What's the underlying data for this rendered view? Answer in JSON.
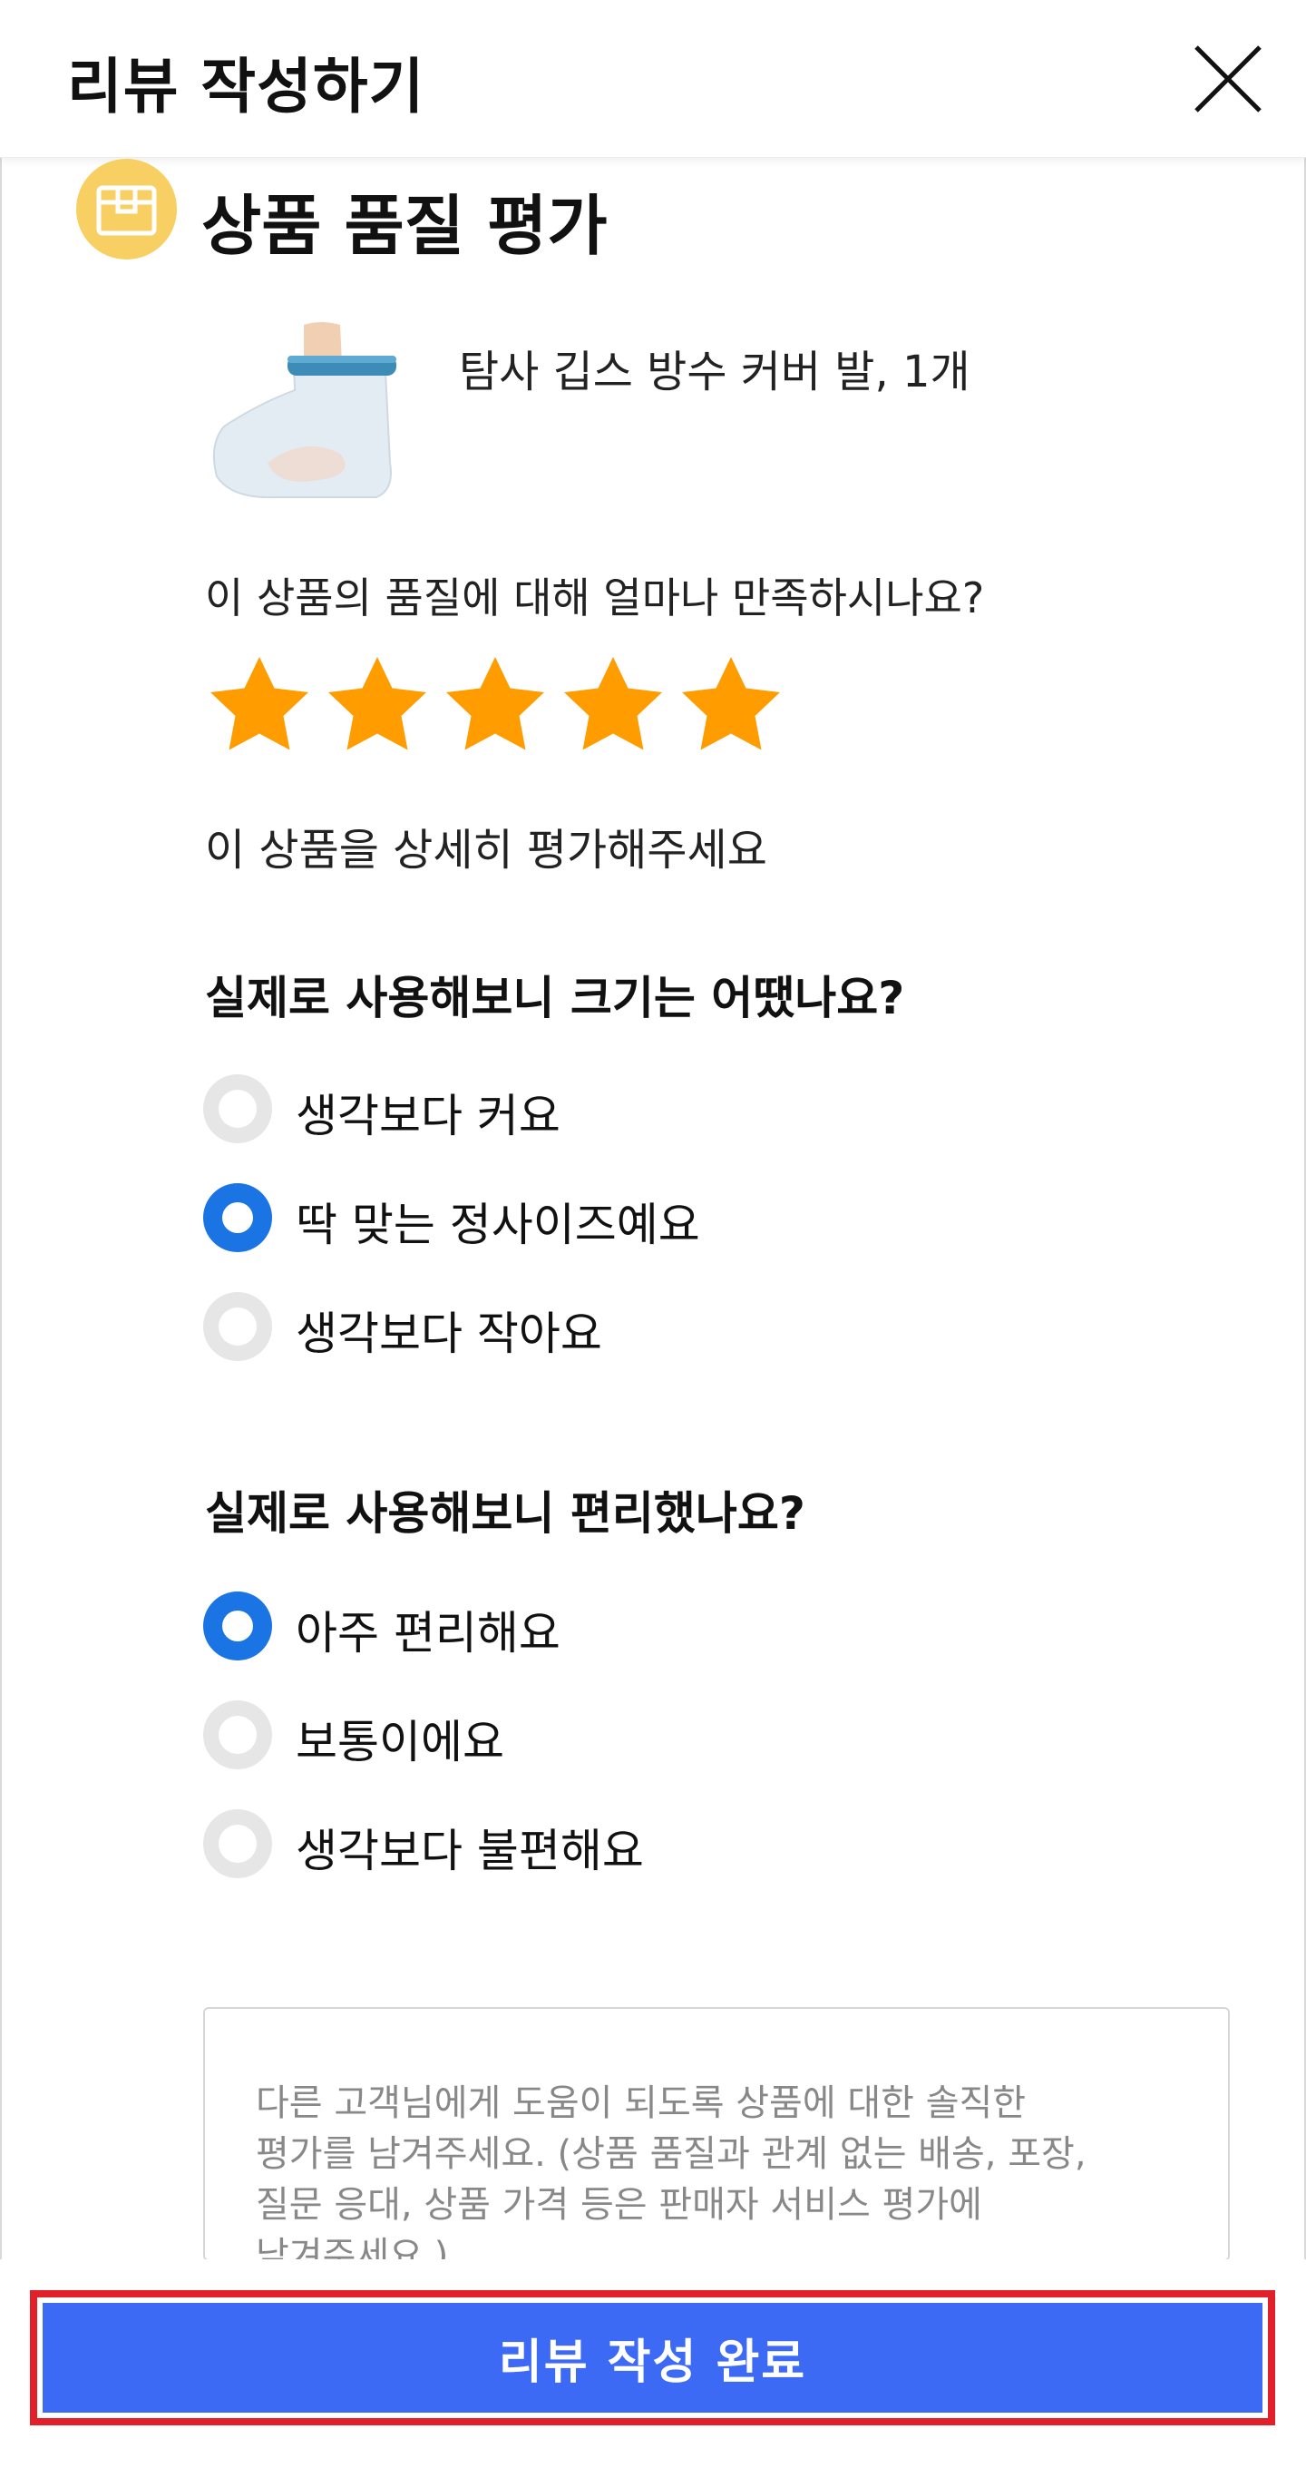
{
  "header": {
    "title": "리뷰 작성하기",
    "close_icon": "close-icon"
  },
  "section": {
    "title": "상품 품질 평가",
    "icon": "box-icon",
    "icon_color": "#f7cf62"
  },
  "product": {
    "name": "탐사 깁스 방수 커버 발, 1개",
    "image": "foot-cast-cover-image"
  },
  "rating": {
    "question": "이 상품의 품질에 대해 얼마나 만족하시나요?",
    "value": 5,
    "max": 5,
    "star_color": "#ff9c00"
  },
  "detail_label": "이 상품을 상세히 평가해주세요",
  "questions": [
    {
      "title": "실제로 사용해보니 크기는 어땠나요?",
      "options": [
        {
          "label": "생각보다 커요",
          "selected": false
        },
        {
          "label": "딱 맞는 정사이즈예요",
          "selected": true
        },
        {
          "label": "생각보다 작아요",
          "selected": false
        }
      ]
    },
    {
      "title": "실제로 사용해보니 편리했나요?",
      "options": [
        {
          "label": "아주 편리해요",
          "selected": true
        },
        {
          "label": "보통이에요",
          "selected": false
        },
        {
          "label": "생각보다 불편해요",
          "selected": false
        }
      ]
    }
  ],
  "review_input": {
    "placeholder": "다른 고객님에게 도움이 되도록 상품에 대한 솔직한\n평가를 남겨주세요. (상품 품질과 관계 없는 배송, 포장,\n질문 응대, 상품 가격 등은 판매자 서비스 평가에\n남겨주세요.)"
  },
  "submit": {
    "label": "리뷰 작성 완료",
    "color": "#3d6af5",
    "highlight_color": "#e2202a"
  }
}
